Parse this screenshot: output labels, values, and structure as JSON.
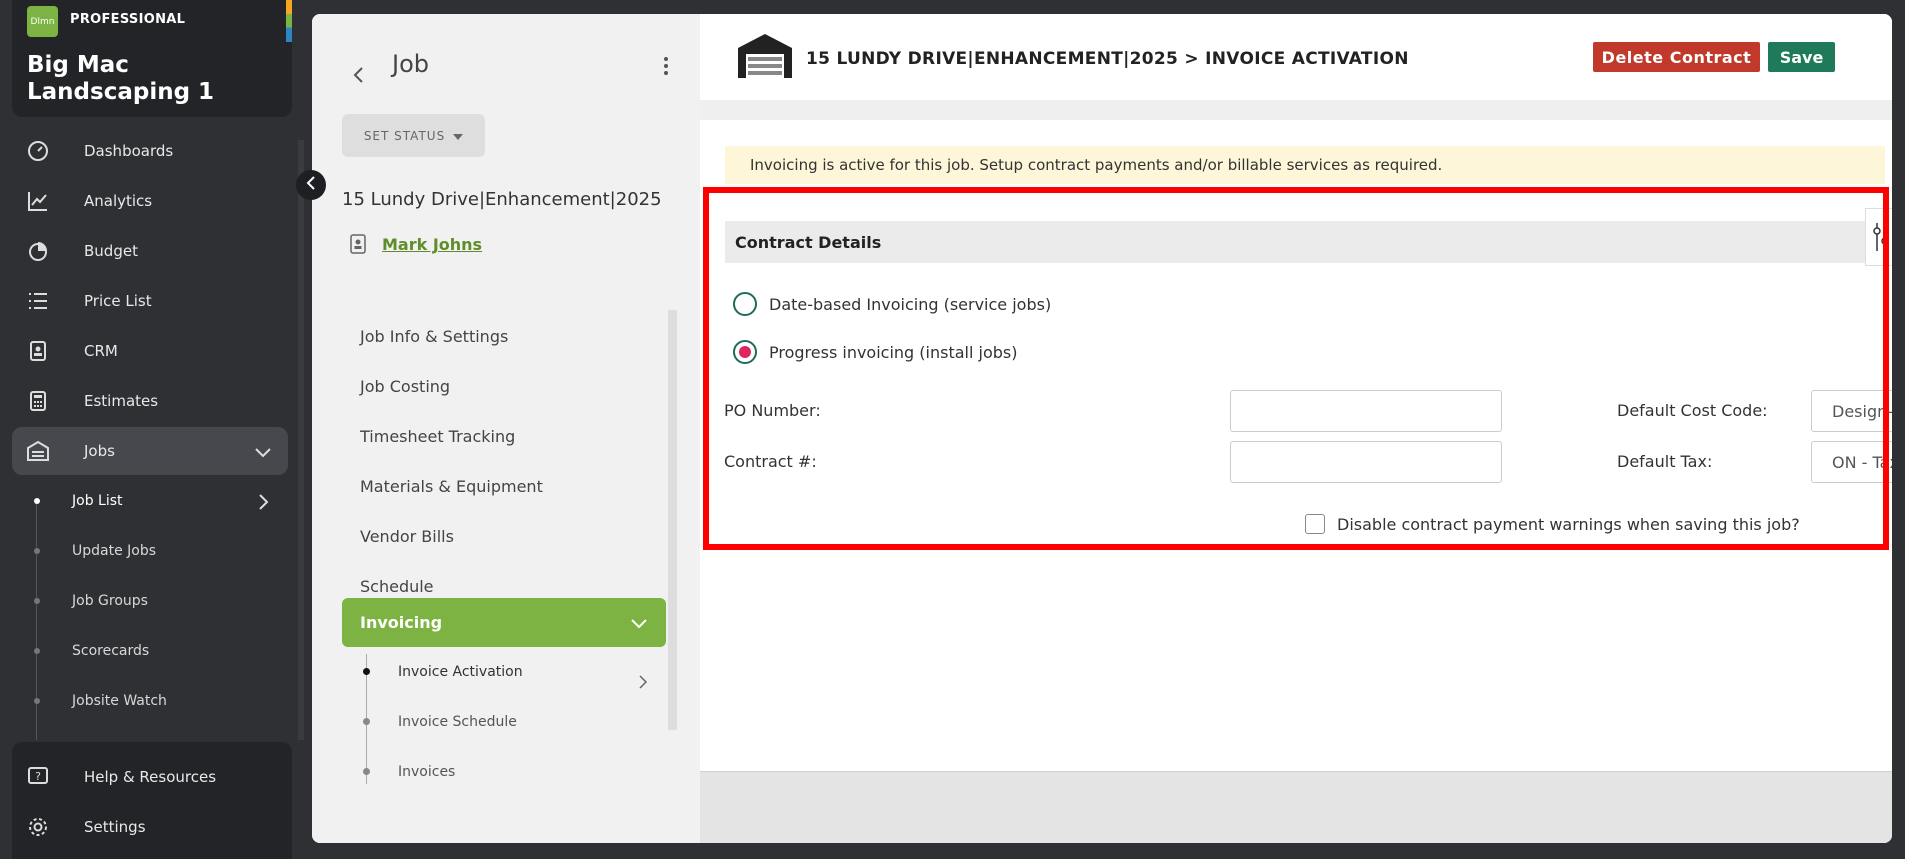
{
  "nav": {
    "logo_text": "Dlmn",
    "plan": "PROFESSIONAL",
    "company": "Big Mac Landscaping 1",
    "items": [
      {
        "label": "Dashboards",
        "icon": "dashboard-gauge-icon"
      },
      {
        "label": "Analytics",
        "icon": "line-chart-icon"
      },
      {
        "label": "Budget",
        "icon": "pie-chart-icon"
      },
      {
        "label": "Price List",
        "icon": "list-icon"
      },
      {
        "label": "CRM",
        "icon": "contact-card-icon"
      },
      {
        "label": "Estimates",
        "icon": "calculator-icon"
      },
      {
        "label": "Jobs",
        "icon": "garage-icon"
      }
    ],
    "jobs_sub": [
      "Job List",
      "Update Jobs",
      "Job Groups",
      "Scorecards",
      "Jobsite Watch"
    ],
    "bottom": [
      {
        "label": "Help & Resources",
        "icon": "help-icon"
      },
      {
        "label": "Settings",
        "icon": "gear-icon"
      }
    ]
  },
  "subnav": {
    "title": "Job",
    "set_status": "SET STATUS",
    "job_name": "15 Lundy Drive|Enhancement|2025",
    "contact": "Mark Johns",
    "menu": [
      "Job Info & Settings",
      "Job Costing",
      "Timesheet Tracking",
      "Materials & Equipment",
      "Vendor Bills",
      "Schedule"
    ],
    "active": "Invoicing",
    "invoicing_sub": [
      "Invoice Activation",
      "Invoice Schedule",
      "Invoices"
    ]
  },
  "content": {
    "title": "15 LUNDY DRIVE|ENHANCEMENT|2025 > INVOICE ACTIVATION",
    "delete_label": "Delete Contract",
    "save_label": "Save",
    "alert": "Invoicing is active for this job. Setup contract payments and/or billable services as required.",
    "section_title": "Contract Details",
    "radio_date": "Date-based Invoicing (service jobs)",
    "radio_progress": "Progress invoicing (install jobs)",
    "po_label": "PO Number:",
    "po_value": "",
    "contract_label": "Contract #:",
    "contract_value": "",
    "cost_code_label": "Default Cost Code:",
    "cost_code_value": "Design-Build",
    "tax_label": "Default Tax:",
    "tax_value": "ON - Tax",
    "disable_warnings_label": "Disable contract payment warnings when saving this job?"
  },
  "colors": {
    "accent_green": "#7cb342",
    "danger": "#c0392b",
    "save": "#1f7a5a",
    "highlight": "#ff0000"
  }
}
